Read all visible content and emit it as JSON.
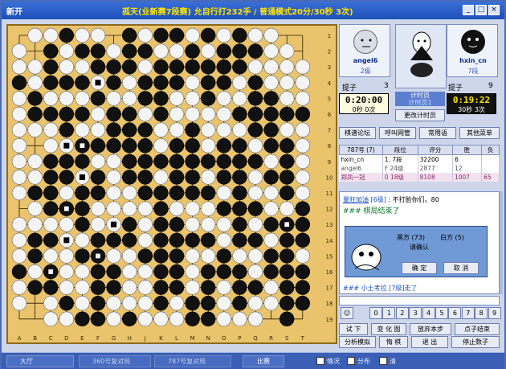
{
  "window": {
    "title": "新开",
    "game_info": "孤天(业新赛7段赛) 允自行打232手 / 普通模式20分/30秒 3次)",
    "controls": [
      "_",
      "□",
      "×"
    ]
  },
  "board": {
    "size": 19,
    "col_labels": [
      "A",
      "B",
      "C",
      "D",
      "E",
      "F",
      "G",
      "H",
      "J",
      "K",
      "L",
      "M",
      "N",
      "O",
      "P",
      "Q",
      "R",
      "S",
      "T"
    ],
    "row_labels": [
      "1",
      "2",
      "3",
      "4",
      "5",
      "6",
      "7",
      "8",
      "9",
      "10",
      "11",
      "12",
      "13",
      "14",
      "15",
      "16",
      "17",
      "18",
      "19"
    ],
    "colors": {
      "wood": "#e9c46d",
      "grid": "#2a1a00",
      "black": "#111111",
      "white": "#f4f4f4"
    },
    "rows": [
      ".WWBWW.BWBBWBWBWW..",
      "W.BWBBWBBWWBWBBBWW.",
      "WWBWWBBBWBBBBBBWWWW",
      "BWBBBWBWBBBWBBWBWWW",
      "WBWWWBWWBBWWBWWBBWW",
      "WBBBBWBBWBWWWWBBBBB",
      "WWWBWWBBBWWBWWWBBWW",
      "W.WWBBBBBWBBWBBWBBW",
      "WWBBBWWBBBBBBBBBWBW",
      "WWBBWBWBBWBBWBBWBBW",
      "WBBWBBWWBBBBBWBWWBW",
      ".WBBBWWWWBWWWBBBWWB",
      "WWWWBWWBWBBWWWBWBBB",
      "WBBWWBBBWBBBBWBBWBB",
      "WBWWBBWWBBBWWBWWBBW",
      "BWBWWBBWWBBWBBBWBBB",
      "WBBWWBBWWBBWBWBBWBB",
      "W.WBWBWWWBWBBWBWWBB",
      "..WWBBWBWWWBBWWW.B."
    ],
    "marked": [
      [
        9,
        4
      ],
      [
        11,
        3
      ],
      [
        13,
        3
      ],
      [
        15,
        2
      ],
      [
        12,
        17
      ],
      [
        3,
        5
      ],
      [
        7,
        4
      ],
      [
        7,
        3
      ],
      [
        12,
        6
      ],
      [
        14,
        5
      ]
    ]
  },
  "players": {
    "white": {
      "name": "angel6",
      "rank": "2级",
      "captures_label": "提子",
      "captures": "3",
      "time": "0:20:00",
      "status": "0秒 0次"
    },
    "black": {
      "name": "hxin_cn",
      "rank": "7段",
      "captures_label": "提子",
      "captures": "9",
      "time": "0:19:22",
      "status": "30秒 3次"
    },
    "referee": {
      "label": "计时员",
      "sub": "计时员1",
      "change_button": "更改计时员"
    }
  },
  "actions": [
    "棋谱论坛",
    "呼叫网管",
    "常用语",
    "其他菜单"
  ],
  "room_table": {
    "headers": [
      "787号 (7)",
      "段位",
      "评分",
      "胜",
      "负"
    ],
    "rows": [
      [
        "hxin_cn",
        "1. 7段",
        "32200",
        "6",
        ""
      ],
      [
        "angel6",
        "F 24级",
        "2877",
        "12",
        ""
      ],
      [
        "郑凤一冠",
        "0 18级",
        "8108",
        "1007",
        "65"
      ]
    ]
  },
  "chat": {
    "line1_name": "量狂加油",
    "line1_rank": "[6级]",
    "line1_msg": ": 不打脸你们。80",
    "line2": "### 棋局结束了",
    "dialog_lines": [
      "黑方 (73)",
      "白方 (5)",
      "请确认"
    ],
    "dialog_ok": "确 定",
    "dialog_cancel": "取 消",
    "footer": "### 小土考拉 [7级]走了"
  },
  "numbers": [
    "0",
    "1",
    "2",
    "3",
    "4",
    "5",
    "6",
    "7",
    "8",
    "9"
  ],
  "bottom_buttons_row1": [
    "试 下",
    "变 化 图",
    "放弃本步",
    "点子结束"
  ],
  "bottom_buttons_row2": [
    "分析模拟",
    "悔 棋",
    "退 出",
    "停止数子"
  ],
  "statusbar": {
    "tabs": [
      "大厅",
      "360号复对局",
      "787号复对局"
    ],
    "match_button": "比赛",
    "checks": [
      "情况",
      "分布",
      "清"
    ]
  }
}
